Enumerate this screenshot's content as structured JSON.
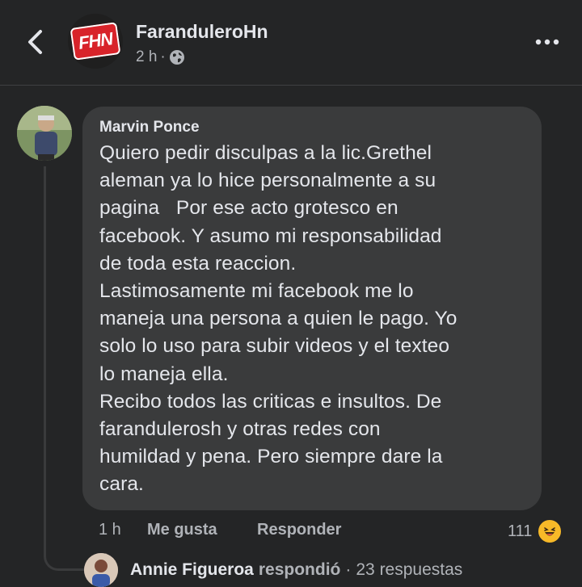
{
  "header": {
    "page_name": "FaranduleroHn",
    "logo_text": "FHN",
    "post_time": "2 h",
    "separator": "·",
    "privacy_icon": "globe-icon",
    "back_icon": "chevron-left-icon",
    "more_icon": "more-horizontal-icon"
  },
  "comment": {
    "author": "Marvin Ponce",
    "lines": [
      "Quiero pedir disculpas a la lic.Grethel",
      "aleman ya lo hice personalmente a su",
      "pagina   Por ese acto grotesco en",
      "facebook. Y asumo mi responsabilidad",
      "de toda esta reaccion.",
      "Lastimosamente mi facebook me lo",
      "maneja una persona a quien le pago. Yo",
      "solo lo uso para subir videos y el texteo",
      "lo maneja ella.",
      "Recibo todos las criticas e insultos. De",
      "farandulerosh y otras redes con",
      "humildad y pena. Pero siempre dare la",
      "cara."
    ],
    "time": "1 h",
    "like_label": "Me gusta",
    "reply_label": "Responder",
    "reaction_count": "111",
    "reaction_icon": "laughing-emoji-icon"
  },
  "reply_preview": {
    "name": "Annie Figueroa",
    "verb": "respondió",
    "separator": "·",
    "replies": "23 respuestas"
  },
  "colors": {
    "background": "#242526",
    "bubble": "#3a3b3c",
    "text": "#e4e6eb",
    "secondary_text": "#b0b3b8",
    "logo_red": "#d8232a",
    "reaction_yellow": "#f7b928"
  }
}
